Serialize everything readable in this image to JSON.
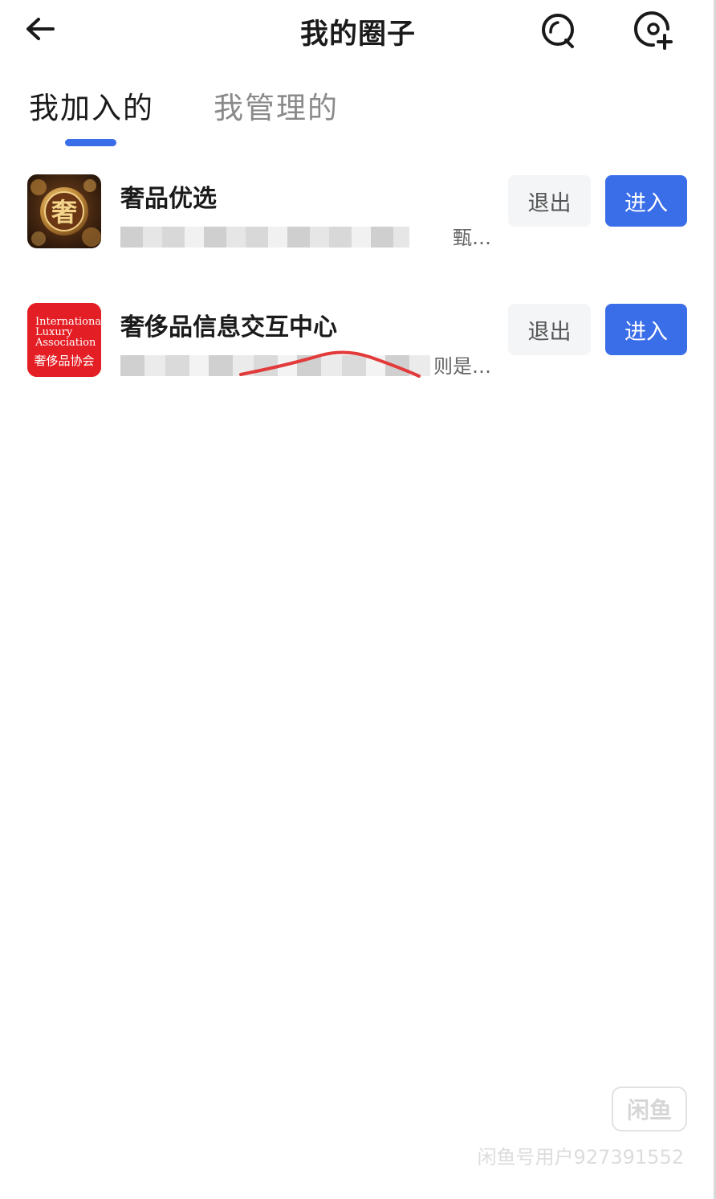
{
  "header": {
    "title": "我的圈子"
  },
  "tabs": [
    {
      "label": "我加入的",
      "active": true
    },
    {
      "label": "我管理的",
      "active": false
    }
  ],
  "circles": [
    {
      "name": "奢品优选",
      "desc_tail": "甄…",
      "quit_label": "退出",
      "enter_label": "进入"
    },
    {
      "name": "奢侈品信息交互中心",
      "desc_tail": "则是…",
      "quit_label": "退出",
      "enter_label": "进入",
      "avatar_lines": [
        "International",
        "Luxury",
        "Association",
        "奢侈品协会"
      ]
    }
  ],
  "watermark": {
    "logo": "闲鱼",
    "text": "闲鱼号用户927391552"
  },
  "colors": {
    "accent": "#3a6de8",
    "avatar_red": "#e31e24",
    "quit_bg": "#f4f5f7"
  }
}
